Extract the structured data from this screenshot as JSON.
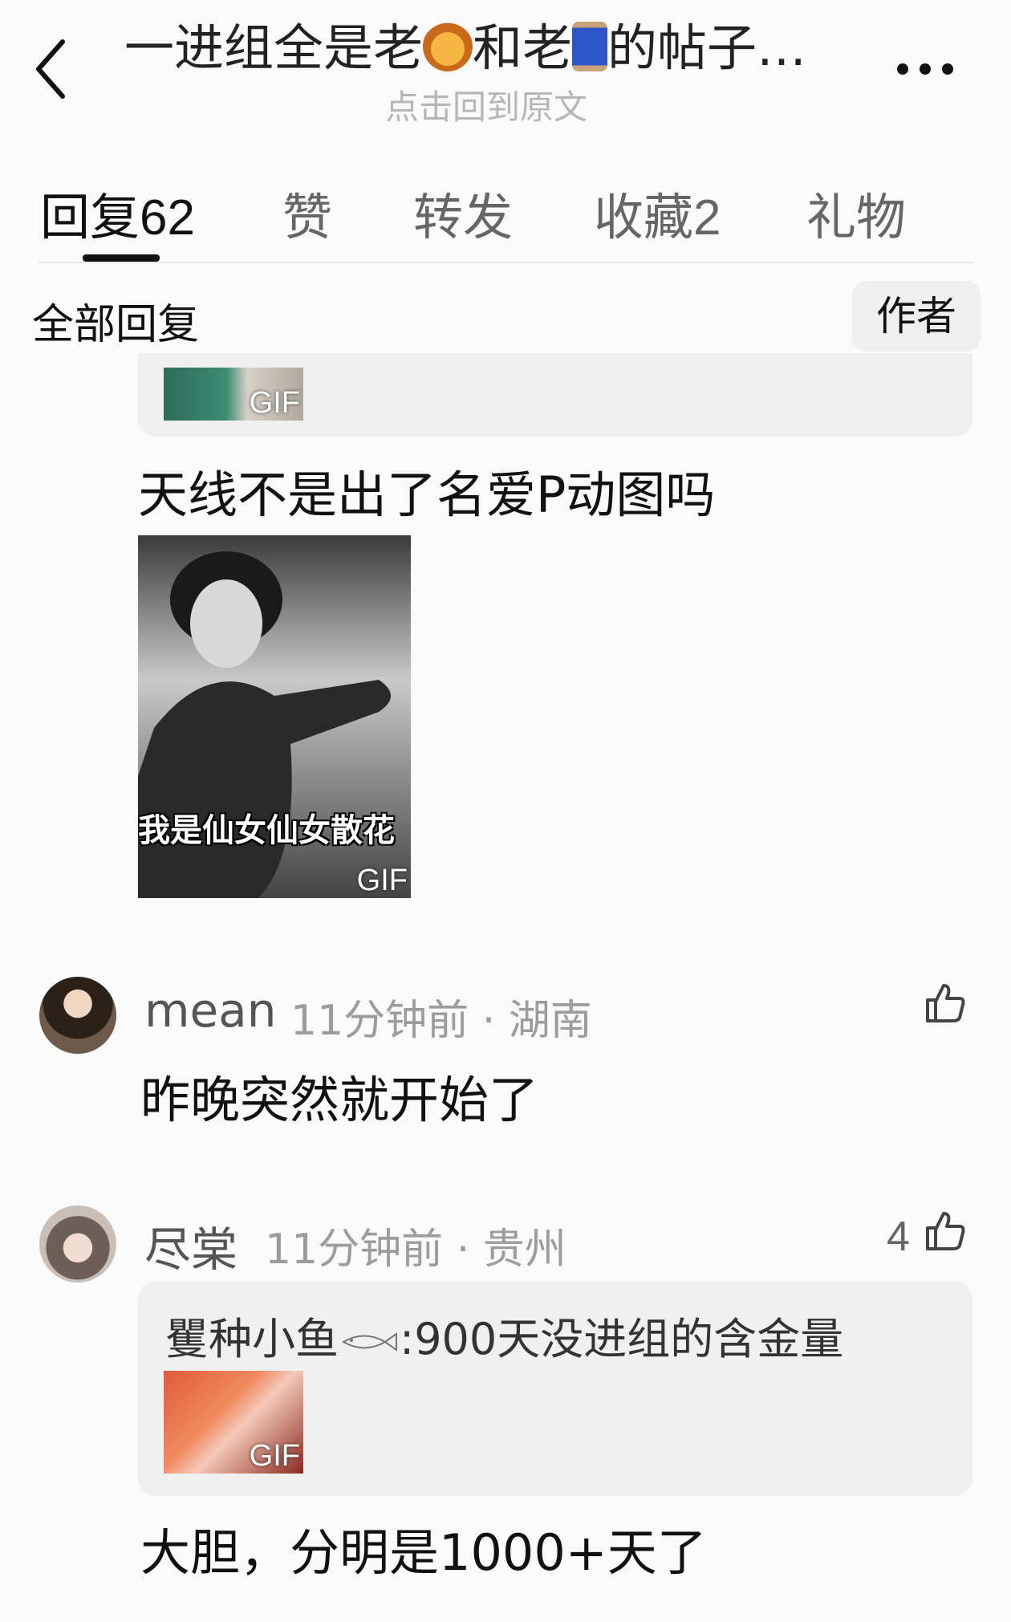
{
  "header": {
    "title_part1": "一进组全是老",
    "title_emoji1": "lion-emoji",
    "title_part2": "和老",
    "title_emoji2": "thread-spool-emoji",
    "title_part3": "的帖子…",
    "subtitle": "点击回到原文",
    "back_icon": "chevron-left-icon",
    "more_icon": "more-horizontal-icon"
  },
  "tabs": [
    {
      "label": "回复",
      "count": "62",
      "active": true
    },
    {
      "label": "赞",
      "count": ""
    },
    {
      "label": "转发",
      "count": ""
    },
    {
      "label": "收藏",
      "count": "2"
    },
    {
      "label": "礼物",
      "count": ""
    }
  ],
  "section": {
    "title": "全部回复",
    "author_filter": "作者"
  },
  "top_reply": {
    "quote_gif_badge": "GIF",
    "text": "天线不是出了名爱P动图吗",
    "gif_caption": "我是仙女仙女散花",
    "gif_badge": "GIF"
  },
  "comments": [
    {
      "user": "mean",
      "time": "11分钟前",
      "location": "湖南",
      "separator": "·",
      "likes": "",
      "text": "昨晚突然就开始了"
    },
    {
      "user": "尽棠",
      "time": "11分钟前",
      "location": "贵州",
      "separator": "·",
      "likes": "4",
      "quote_user": "矍种小鱼",
      "quote_icon": "fish-icon",
      "quote_sep": ":",
      "quote_text": "900天没进组的含金量",
      "quote_gif_badge": "GIF",
      "text": "大胆，分明是1000+天了"
    }
  ],
  "colors": {
    "background": "#fafafa",
    "card": "#f0f0f0",
    "muted": "#9c9c9c"
  }
}
